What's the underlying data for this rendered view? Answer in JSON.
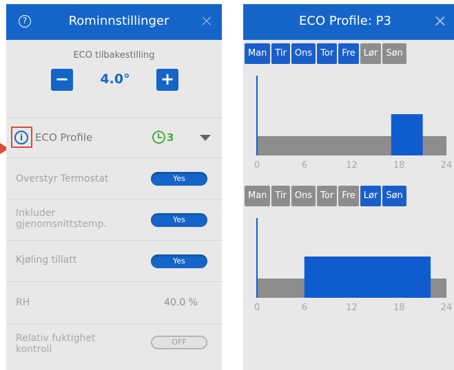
{
  "left_panel": {
    "title": "Rominnstillinger",
    "help_icon": "?",
    "close_icon": "×",
    "eco_reset": {
      "label": "ECO tilbakestilling",
      "value": "4.0°",
      "minus_label": "−",
      "plus_label": "+"
    },
    "eco_profile": {
      "info_glyph": "i",
      "label": "ECO Profile",
      "profile_number": "3"
    },
    "rows": [
      {
        "label": "Overstyr Termostat",
        "toggle": "Yes"
      },
      {
        "label_line1": "Inkluder",
        "label_line2": "gjenomsnittstemp.",
        "toggle": "Yes"
      },
      {
        "label": "Kjøling tillatt",
        "toggle": "Yes"
      },
      {
        "label": "RH",
        "value": "40.0 %"
      },
      {
        "label_line1": "Relativ fuktighet",
        "label_line2": "kontroll",
        "toggle": "OFF"
      }
    ]
  },
  "right_panel": {
    "title": "ECO Profile: P3",
    "close_icon": "×",
    "day_groups": [
      {
        "days": [
          {
            "label": "Man",
            "active": true
          },
          {
            "label": "Tir",
            "active": true
          },
          {
            "label": "Ons",
            "active": true
          },
          {
            "label": "Tor",
            "active": true
          },
          {
            "label": "Fre",
            "active": true
          },
          {
            "label": "Lør",
            "active": false
          },
          {
            "label": "Søn",
            "active": false
          }
        ]
      },
      {
        "days": [
          {
            "label": "Man",
            "active": false
          },
          {
            "label": "Tir",
            "active": false
          },
          {
            "label": "Ons",
            "active": false
          },
          {
            "label": "Tor",
            "active": false
          },
          {
            "label": "Fre",
            "active": false
          },
          {
            "label": "Lør",
            "active": true
          },
          {
            "label": "Søn",
            "active": true
          }
        ]
      }
    ]
  },
  "chart_data": [
    {
      "type": "bar",
      "x_ticks": [
        "0",
        "6",
        "12",
        "18",
        "24"
      ],
      "xlim": [
        0,
        24
      ],
      "eco_periods": [
        {
          "start": 17,
          "end": 21
        }
      ]
    },
    {
      "type": "bar",
      "x_ticks": [
        "0",
        "6",
        "12",
        "18",
        "24"
      ],
      "xlim": [
        0,
        24
      ],
      "eco_periods": [
        {
          "start": 6,
          "end": 22
        }
      ]
    }
  ],
  "colors": {
    "header_blue": "#1565c8",
    "eco_bar": "#0f5cd0",
    "comfort_bar": "#8d8d8d",
    "profile_green": "#3dae3d",
    "highlight_red": "#e2463a"
  }
}
